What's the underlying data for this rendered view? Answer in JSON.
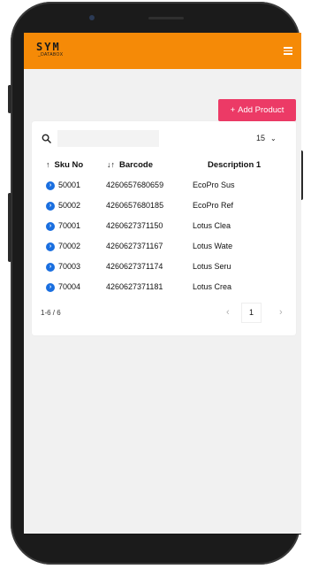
{
  "app": {
    "logo_main": "SYM",
    "logo_sub": "_DATABOX",
    "menu_icon": "hamburger-icon",
    "accent_color": "#f58a07",
    "add_button_color": "#ec3a66"
  },
  "toolbar": {
    "add_label": "Add Product",
    "add_icon": "+"
  },
  "search": {
    "icon": "search-icon",
    "value": "",
    "placeholder": ""
  },
  "page_size": {
    "value": "15",
    "icon": "chevron-down-icon"
  },
  "table": {
    "columns": [
      {
        "label": "Sku No",
        "sort_icon": "↑"
      },
      {
        "label": "Barcode",
        "sort_icon": "↓↑"
      },
      {
        "label": "Description 1",
        "sort_icon": ""
      }
    ],
    "rows": [
      {
        "sku": "50001",
        "barcode": "4260657680659",
        "desc": "EcoPro Sus"
      },
      {
        "sku": "50002",
        "barcode": "4260657680185",
        "desc": "EcoPro Ref"
      },
      {
        "sku": "70001",
        "barcode": "4260627371150",
        "desc": "Lotus Clea"
      },
      {
        "sku": "70002",
        "barcode": "4260627371167",
        "desc": "Lotus Wate"
      },
      {
        "sku": "70003",
        "barcode": "4260627371174",
        "desc": "Lotus Seru"
      },
      {
        "sku": "70004",
        "barcode": "4260627371181",
        "desc": "Lotus Crea"
      }
    ],
    "badge_color": "#1a6fe0"
  },
  "pagination": {
    "info": "1-6 / 6",
    "current": "1",
    "prev": "‹",
    "next": "›"
  }
}
